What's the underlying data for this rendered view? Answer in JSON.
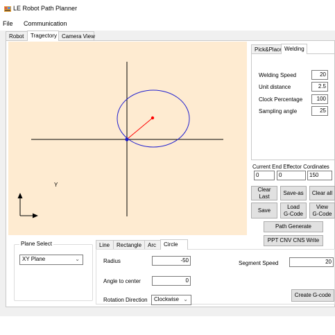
{
  "window": {
    "title": "LE Robot Path Planner",
    "icon": "app-icon"
  },
  "menu": {
    "file": "File",
    "communication": "Communication"
  },
  "main_tabs": {
    "robot": "Robot",
    "trajectory": "Tragectory",
    "camera_view": "Camera View",
    "active": "Tragectory"
  },
  "canvas": {
    "background": "#feebd1",
    "axis_label_y": "Y",
    "circle_color": "#2020d0",
    "radius_line_color": "#ff0000",
    "axis_color": "#000000"
  },
  "right_tabs": {
    "pick_place": "Pick&Place",
    "welding": "Welding",
    "active": "Welding"
  },
  "welding": {
    "speed_label": "Welding Speed",
    "speed_value": "20",
    "unit_distance_label": "Unit distance",
    "unit_distance_value": "2.5",
    "clock_percentage_label": "Clock Percentage",
    "clock_percentage_value": "100",
    "sampling_angle_label": "Sampling angle",
    "sampling_angle_value": "25"
  },
  "end_effector": {
    "label": "Current End Effector Cordinates",
    "x": "0",
    "y": "0",
    "z": "150"
  },
  "buttons": {
    "clear_last": "Clear Last",
    "save_as": "Save-as",
    "clear_all": "Clear all",
    "save": "Save",
    "load_gcode_line1": "Load",
    "load_gcode_line2": "G-Code",
    "view_gcode_line1": "View",
    "view_gcode_line2": "G-Code",
    "path_generate": "Path Generate",
    "ppt_write": "PPT CNV CNS Write",
    "create_gcode": "Create G-code"
  },
  "plane_select": {
    "label": "Plane Select",
    "value": "XY Plane"
  },
  "shape_tabs": {
    "line": "Line",
    "rectangle": "Rectangle",
    "arc": "Arc",
    "circle": "Circle",
    "active": "Circle"
  },
  "circle": {
    "radius_label": "Radius",
    "radius_value": "-50",
    "angle_label": "Angle to center",
    "angle_value": "0",
    "rotation_label": "Rotation Direction",
    "rotation_value": "Clockwise"
  },
  "segment_speed": {
    "label": "Segment Speed",
    "value": "20"
  }
}
